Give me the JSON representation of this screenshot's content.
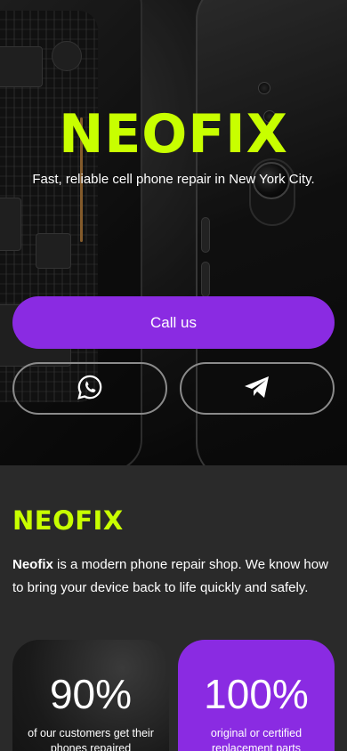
{
  "hero": {
    "brand": "NEOFIX",
    "tagline": "Fast, reliable cell phone repair in New York City.",
    "call_label": "Call us",
    "social": [
      {
        "icon": "whatsapp-icon"
      },
      {
        "icon": "telegram-icon"
      }
    ]
  },
  "about": {
    "title": "NEOFIX",
    "intro_bold": "Neofix",
    "intro_rest": " is a modern phone repair shop. We know how to bring your device back to life quickly and safely."
  },
  "stats": [
    {
      "value": "90%",
      "label": "of our customers get their phones repaired"
    },
    {
      "value": "100%",
      "label": "original or certified replacement parts"
    }
  ],
  "colors": {
    "accent": "#c8ff00",
    "primary": "#8a2be2",
    "background": "#2a2a2a"
  }
}
